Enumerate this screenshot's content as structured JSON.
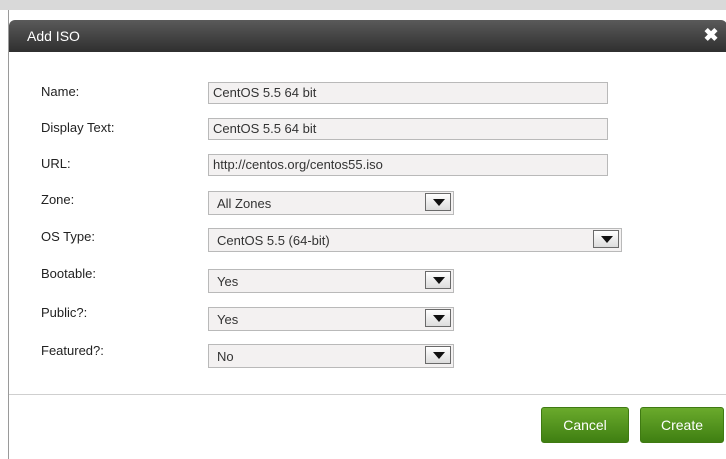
{
  "dialog": {
    "title": "Add ISO",
    "close_icon": "close-icon"
  },
  "form": {
    "name": {
      "label": "Name:",
      "value": "CentOS 5.5 64 bit"
    },
    "display_text": {
      "label": "Display Text:",
      "value": "CentOS 5.5 64 bit"
    },
    "url": {
      "label": "URL:",
      "value": "http://centos.org/centos55.iso"
    },
    "zone": {
      "label": "Zone:",
      "value": "All Zones"
    },
    "os_type": {
      "label": "OS Type:",
      "value": "CentOS 5.5 (64-bit)"
    },
    "bootable": {
      "label": "Bootable:",
      "value": "Yes"
    },
    "public": {
      "label": "Public?:",
      "value": "Yes"
    },
    "featured": {
      "label": "Featured?:",
      "value": "No"
    }
  },
  "actions": {
    "cancel_label": "Cancel",
    "create_label": "Create"
  },
  "colors": {
    "titlebar": "#3c3c3c",
    "button_green": "#4f9220",
    "field_bg": "#f3f1f1"
  }
}
